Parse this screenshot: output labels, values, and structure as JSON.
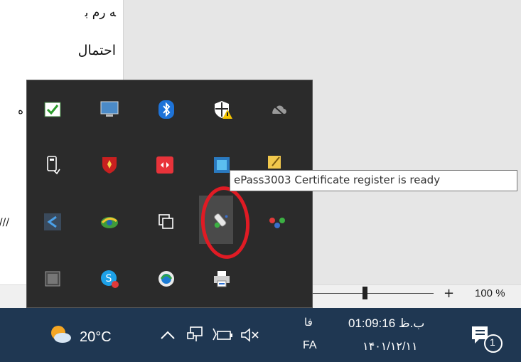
{
  "document": {
    "lines": [
      "ﻪ رم ﺑ",
      "اﺣﺘﻤﺎل",
      "ه",
      "///"
    ]
  },
  "status_bar": {
    "zoom_plus": "+",
    "zoom_level": "100 %"
  },
  "tooltip": {
    "text": "ePass3003 Certificate register is ready"
  },
  "tray_icons": [
    {
      "name": "task-check-icon"
    },
    {
      "name": "monitor-icon"
    },
    {
      "name": "bluetooth-icon"
    },
    {
      "name": "security-shield-warning-icon"
    },
    {
      "name": "cloud-offline-icon"
    },
    {
      "name": "usb-drive-icon"
    },
    {
      "name": "shield-app-icon"
    },
    {
      "name": "remote-app-icon"
    },
    {
      "name": "network-app-icon"
    },
    {
      "name": "sticky-app-icon"
    },
    {
      "name": "s-logo-icon"
    },
    {
      "name": "globe-app-icon"
    },
    {
      "name": "copy-windows-icon"
    },
    {
      "name": "epass-token-icon"
    },
    {
      "name": "dots-app-icon"
    },
    {
      "name": "keyboard-grid-icon"
    },
    {
      "name": "skype-icon"
    },
    {
      "name": "browser-globe-icon"
    },
    {
      "name": "printer-icon"
    }
  ],
  "taskbar": {
    "weather_temp": "20°C",
    "lang_top": "فا",
    "lang_bottom": "FA",
    "clock_time": "01:09:16 ب.ظ",
    "clock_date": "۱۴۰۱/۱۲/۱۱",
    "notification_count": "1",
    "colors": {
      "taskbar": "#1f3752",
      "accent": "#e01b24"
    }
  }
}
